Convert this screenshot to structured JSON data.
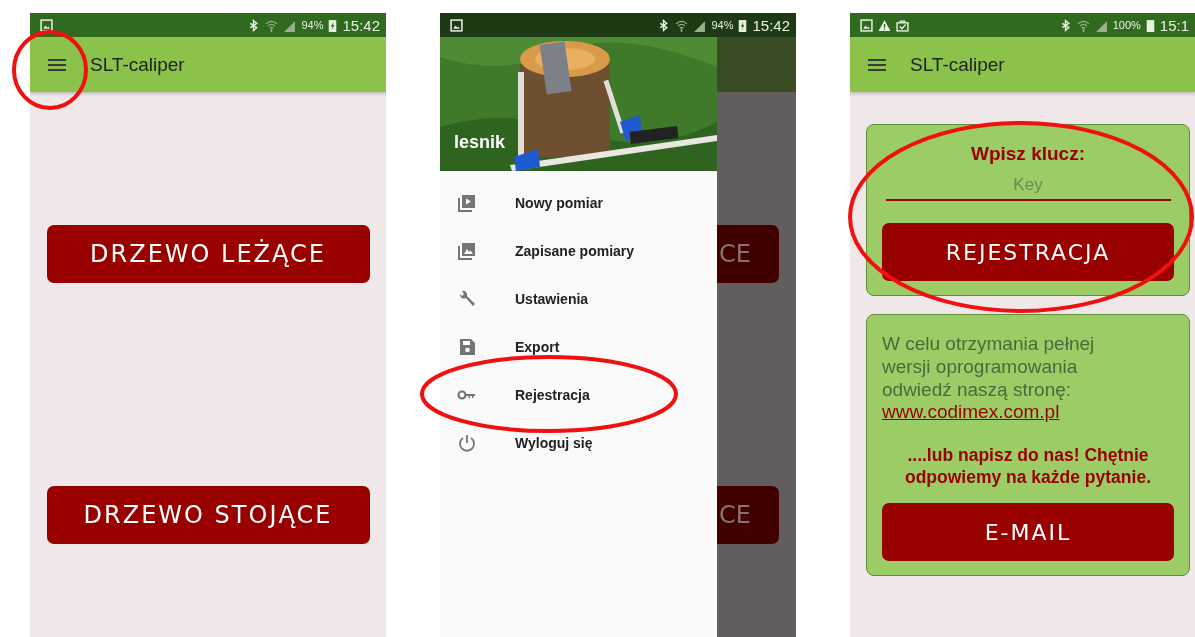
{
  "home": {
    "status_bar": {
      "battery": "94%",
      "charging": true,
      "time": "15:42"
    },
    "app_bar": {
      "title": "SLT-caliper"
    },
    "buttons": [
      "DRZEWO LEŻĄCE",
      "DRZEWO STOJĄCE"
    ]
  },
  "drawer_screen": {
    "status_bar": {
      "battery": "94%",
      "charging": true,
      "time": "15:42"
    },
    "drawer": {
      "user": "lesnik",
      "items": [
        {
          "label": "Nowy pomiar"
        },
        {
          "label": "Zapisane pomiary"
        },
        {
          "label": "Ustawienia"
        },
        {
          "label": "Export"
        },
        {
          "label": "Rejestracja"
        },
        {
          "label": "Wyloguj się"
        }
      ]
    },
    "behind_buttons": [
      "CE",
      "CE"
    ]
  },
  "registration": {
    "status_bar": {
      "battery": "100%",
      "charging": false,
      "time": "15:1"
    },
    "app_bar": {
      "title": "SLT-caliper"
    },
    "key_card": {
      "title": "Wpisz klucz:",
      "placeholder": "Key",
      "button": "REJESTRACJA"
    },
    "info_card": {
      "text": "W celu otrzymania pełnej wersji oprogramowania odwiedź naszą stronę:",
      "link": "www.codimex.com.pl",
      "appeal": "....lub napisz do nas! Chętnie odpowiemy na każde pytanie.",
      "button": "E-MAIL"
    }
  }
}
